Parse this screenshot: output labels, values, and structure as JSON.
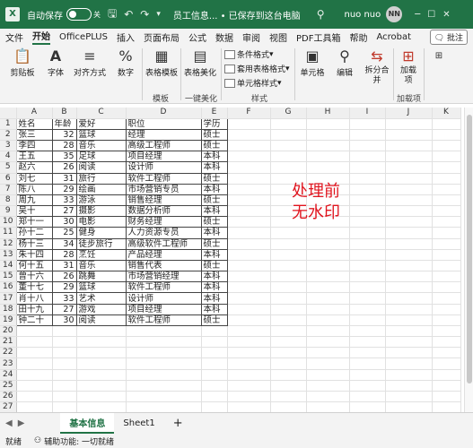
{
  "titlebar": {
    "autosave_label": "自动保存",
    "autosave_state": "关",
    "title": "员工信息... • 已保存到这台电脑",
    "user_name": "nuo nuo",
    "user_initials": "NN",
    "window_minimize": "─",
    "window_restore": "☐",
    "window_close": "✕"
  },
  "menu": {
    "tabs": [
      "文件",
      "开始",
      "OfficePLUS",
      "插入",
      "页面布局",
      "公式",
      "数据",
      "审阅",
      "视图",
      "PDF工具箱",
      "帮助",
      "Acrobat"
    ],
    "active": "开始",
    "annotate_button": "批注"
  },
  "ribbon": {
    "clipboard": "剪贴板",
    "font": "字体",
    "alignment": "对齐方式",
    "number": "数字",
    "table_template": "表格模板",
    "table_beautify": "表格美化",
    "conditional_format": "条件格式",
    "format_as_table": "套用表格格式",
    "cell_styles": "单元格样式",
    "cells": "单元格",
    "editing": "编辑",
    "split_merge": "拆分合并",
    "addin": "加载项",
    "group_template": "模板",
    "group_beautify": "一键美化",
    "group_styles": "样式",
    "group_addins": "加载项"
  },
  "sheet": {
    "columns": [
      "A",
      "B",
      "C",
      "D",
      "E",
      "F",
      "G",
      "H",
      "I",
      "J",
      "K"
    ],
    "rows": [
      [
        "姓名",
        "年龄",
        "爱好",
        "职位",
        "学历"
      ],
      [
        "张三",
        "32",
        "篮球",
        "经理",
        "硕士"
      ],
      [
        "李四",
        "28",
        "音乐",
        "高级工程师",
        "硕士"
      ],
      [
        "王五",
        "35",
        "足球",
        "项目经理",
        "本科"
      ],
      [
        "赵六",
        "26",
        "阅读",
        "设计师",
        "本科"
      ],
      [
        "刘七",
        "31",
        "旅行",
        "软件工程师",
        "硕士"
      ],
      [
        "陈八",
        "29",
        "绘画",
        "市场营销专员",
        "本科"
      ],
      [
        "周九",
        "33",
        "游泳",
        "销售经理",
        "硕士"
      ],
      [
        "吴十",
        "27",
        "摄影",
        "数据分析师",
        "本科"
      ],
      [
        "郑十一",
        "30",
        "电影",
        "财务经理",
        "硕士"
      ],
      [
        "孙十二",
        "25",
        "健身",
        "人力资源专员",
        "本科"
      ],
      [
        "杨十三",
        "34",
        "徒步旅行",
        "高级软件工程师",
        "硕士"
      ],
      [
        "朱十四",
        "28",
        "烹饪",
        "产品经理",
        "本科"
      ],
      [
        "何十五",
        "31",
        "音乐",
        "销售代表",
        "硕士"
      ],
      [
        "曾十六",
        "26",
        "跳舞",
        "市场营销经理",
        "本科"
      ],
      [
        "董十七",
        "29",
        "篮球",
        "软件工程师",
        "本科"
      ],
      [
        "肖十八",
        "33",
        "艺术",
        "设计师",
        "本科"
      ],
      [
        "田十九",
        "27",
        "游戏",
        "项目经理",
        "本科"
      ],
      [
        "钟二十",
        "30",
        "阅读",
        "软件工程师",
        "硕士"
      ]
    ],
    "total_visible_rows": 28,
    "overlay_text_line1": "处理前",
    "overlay_text_line2": "无水印"
  },
  "sheet_tabs": {
    "tabs": [
      "基本信息",
      "Sheet1"
    ],
    "active": "基本信息",
    "add": "+"
  },
  "status": {
    "ready": "就绪",
    "accessibility": "辅助功能: 一切就绪"
  },
  "colors": {
    "brand": "#217346",
    "overlay": "#e0141e"
  }
}
